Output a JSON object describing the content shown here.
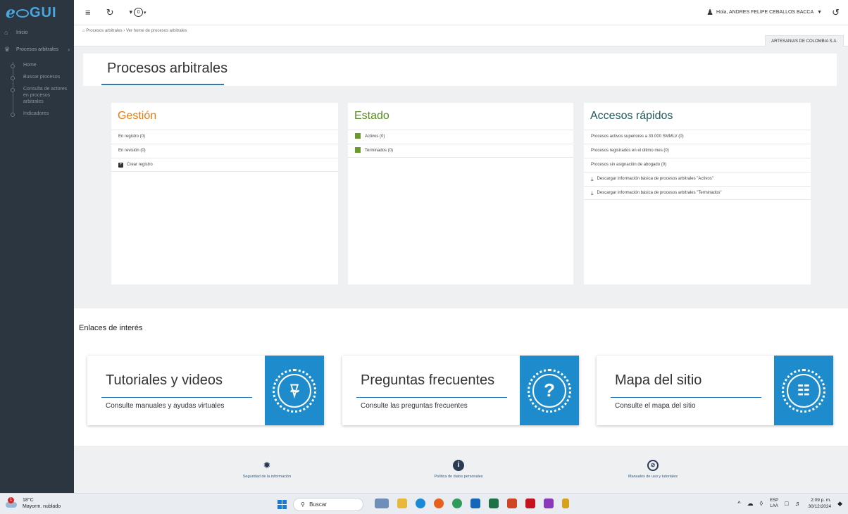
{
  "sidebar": {
    "logo_e": "e",
    "logo_gui": "GUI",
    "items": [
      {
        "label": "Inicio",
        "icon": "home-icon"
      },
      {
        "label": "Procesos arbitrales",
        "icon": "users-icon"
      }
    ],
    "sub_items": [
      "Home",
      "Buscar procesos",
      "Consulta de actores en procesos arbitrales",
      "Indicadores"
    ]
  },
  "topbar": {
    "notif_count": "0",
    "user_label": "Hola, ANDRES FELIPE CEBALLOS BACCA"
  },
  "breadcrumb": "Procesos arbitrales › Ver home de procesos arbitrales",
  "company": "ARTESANIAS DE COLOMBIA S.A.",
  "page_title": "Procesos arbitrales",
  "columns": {
    "gestion": {
      "title": "Gestión",
      "color": "#e37b14",
      "rows": [
        "En registro (0)",
        "En revisión (0)",
        "Crear registro"
      ]
    },
    "estado": {
      "title": "Estado",
      "color": "#5a8a20",
      "rows": [
        "Activos (0)",
        "Terminados (0)"
      ]
    },
    "accesos": {
      "title": "Accesos rápidos",
      "color": "#1f5a5a",
      "rows": [
        "Procesos activos superiores a 33.000 SMMLV (0)",
        "Procesos registrados en el último mes (0)",
        "Procesos sin asignación de abogado (0)",
        "Descargar información básica de procesos arbitrales \"Activos\"",
        "Descargar información básica de procesos arbitrales \"Terminados\""
      ]
    }
  },
  "links": {
    "title": "Enlaces de interés",
    "cards": [
      {
        "title": "Tutoriales y videos",
        "subtitle": "Consulte manuales y ayudas virtuales",
        "icon": "bell-icon"
      },
      {
        "title": "Preguntas frecuentes",
        "subtitle": "Consulte las preguntas frecuentes",
        "icon": "question-icon"
      },
      {
        "title": "Mapa del sitio",
        "subtitle": "Consulte el mapa del sitio",
        "icon": "sitemap-icon"
      }
    ]
  },
  "footer": {
    "items": [
      "Seguridad de la información",
      "Política de datos personales",
      "Manuales de uso y tutoriales"
    ]
  },
  "taskbar": {
    "temp": "18°C",
    "weather": "Mayorm. nublado",
    "weather_badge": "1",
    "search": "Buscar",
    "lang1": "ESP",
    "lang2": "LAA",
    "time": "2:09 p. m.",
    "date": "30/12/2024"
  }
}
